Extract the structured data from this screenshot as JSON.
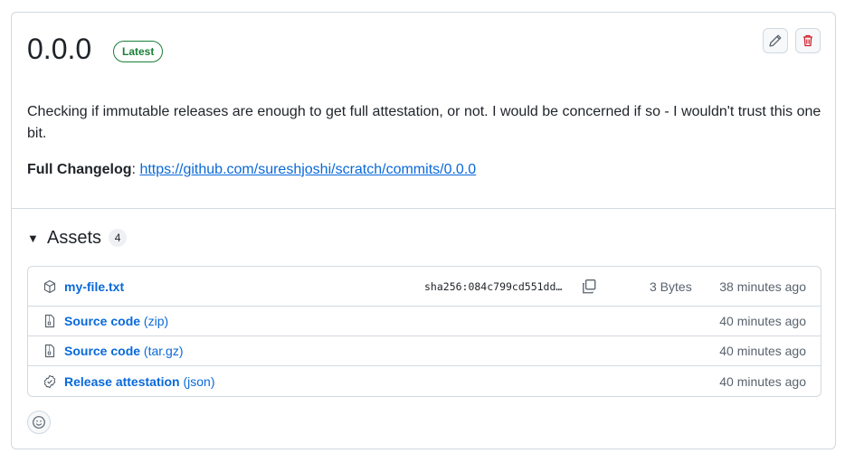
{
  "release": {
    "title": "0.0.0",
    "badge": "Latest",
    "description": "Checking if immutable releases are enough to get full attestation, or not. I would be concerned if so - I wouldn't trust this one bit.",
    "changelog_label": "Full Changelog",
    "changelog_sep": ":",
    "changelog_url": "https://github.com/sureshjoshi/scratch/commits/0.0.0"
  },
  "actions": {
    "edit_icon": "pencil-icon",
    "delete_icon": "trash-icon"
  },
  "assets": {
    "title": "Assets",
    "count": "4",
    "items": [
      {
        "icon": "package-icon",
        "name": "my-file.txt",
        "ext": "",
        "sha": "sha256:084c799cd551dd…",
        "size": "3 Bytes",
        "time": "38 minutes ago"
      },
      {
        "icon": "file-zip-icon",
        "name": "Source code",
        "ext": "(zip)",
        "time": "40 minutes ago"
      },
      {
        "icon": "file-zip-icon",
        "name": "Source code",
        "ext": "(tar.gz)",
        "time": "40 minutes ago"
      },
      {
        "icon": "verified-icon",
        "name": "Release attestation",
        "ext": "(json)",
        "time": "40 minutes ago"
      }
    ]
  },
  "colors": {
    "link": "#0969da",
    "success": "#1a7f37",
    "danger": "#cf222e",
    "border": "#d1d9e0"
  }
}
